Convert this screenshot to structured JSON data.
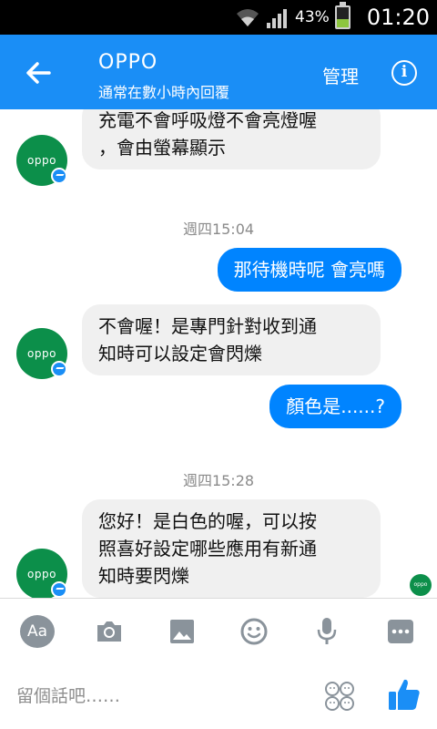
{
  "status_bar": {
    "battery": "43%",
    "time": "01:20",
    "battery_level": 0.43
  },
  "header": {
    "title": "OPPO",
    "subtitle": "通常在數小時內回覆",
    "manage": "管理"
  },
  "avatar_text": "oppo",
  "messages": [
    {
      "type": "in",
      "text": "充電不會呼吸燈不會亮燈喔\n，會由螢幕顯示"
    },
    {
      "type": "timestamp",
      "text": "週四15:04"
    },
    {
      "type": "out",
      "text": "那待機時呢 會亮嗎"
    },
    {
      "type": "in",
      "text": "不會喔！是專門針對收到通\n知時可以設定會閃爍"
    },
    {
      "type": "out",
      "text": "顏色是......?"
    },
    {
      "type": "timestamp",
      "text": "週四15:28"
    },
    {
      "type": "in",
      "text": "您好！是白色的喔，可以按\n照喜好設定哪些應用有新通\n知時要閃爍"
    }
  ],
  "toolbar": {
    "aa_label": "Aa"
  },
  "composer": {
    "placeholder": "留個話吧……"
  },
  "colors": {
    "brand_blue": "#1a8ef6",
    "outgoing_bubble": "#0084ff",
    "incoming_bubble": "#f0f0f0",
    "avatar_green": "#0c8f4a"
  }
}
